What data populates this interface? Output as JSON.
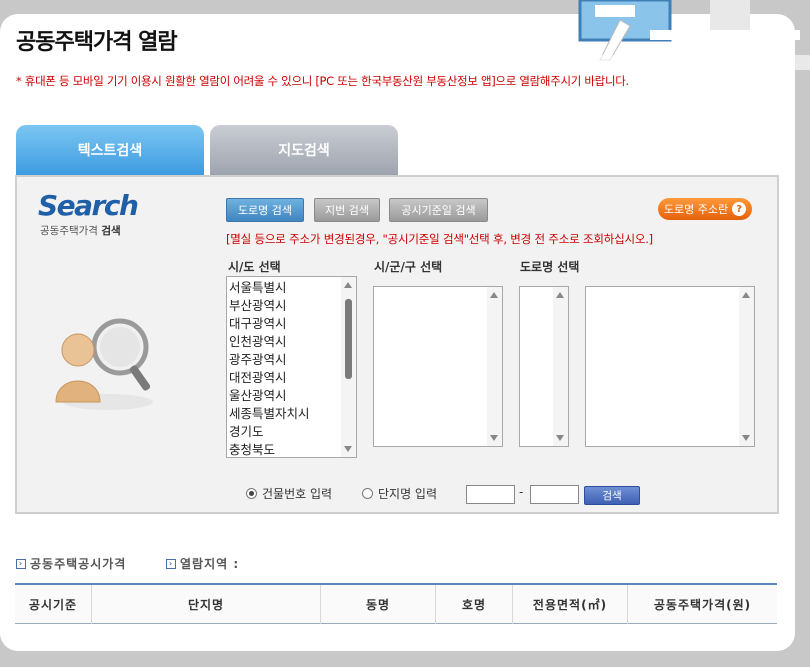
{
  "page": {
    "title": "공동주택가격 열람",
    "notice": "* 휴대폰 등 모바일 기기 이용시 원활한 열람이 어려울 수 있으니 [PC 또는 한국부동산원 부동산정보 앱]으로 열람해주시기 바랍니다."
  },
  "tabs": [
    {
      "label": "텍스트검색",
      "active": true
    },
    {
      "label": "지도검색",
      "active": false
    }
  ],
  "search_panel": {
    "logo_text": "Search",
    "logo_sub_a": "공동주택가격",
    "logo_sub_b": "검색",
    "search_type_buttons": [
      {
        "label": "도로명 검색",
        "active": true
      },
      {
        "label": "지번 검색",
        "active": false
      },
      {
        "label": "공시기준일 검색",
        "active": false
      }
    ],
    "road_address_button": "도로명 주소란",
    "note": "[멸실 등으로 주소가 변경된경우, \"공시기준일 검색\"선택 후, 변경 전 주소로 조회하십시오.]",
    "col_labels": {
      "sido": "시/도 선택",
      "sigungu": "시/군/구 선택",
      "road": "도로명 선택"
    },
    "sido_options": [
      "서울특별시",
      "부산광역시",
      "대구광역시",
      "인천광역시",
      "광주광역시",
      "대전광역시",
      "울산광역시",
      "세종특별자치시",
      "경기도",
      "충청북도"
    ],
    "radio_options": [
      {
        "label": "건물번호 입력",
        "checked": true
      },
      {
        "label": "단지명 입력",
        "checked": false
      }
    ],
    "number_dash": "-",
    "search_button": "검색"
  },
  "results": {
    "label_price": "공동주택공시가격",
    "label_region": "열람지역 :",
    "columns": [
      "공시기준",
      "단지명",
      "동명",
      "호명",
      "전용면적(㎡)",
      "공동주택가격(원)"
    ]
  },
  "colors": {
    "notice_red": "#cc0000",
    "tab_active": "#3d9be0",
    "tab_inactive": "#9ea4ae",
    "button_orange": "#e5600c",
    "table_border": "#5b86bb"
  },
  "icons": {
    "help": "question-circle-icon",
    "section": "chevron-right-box-icon"
  }
}
